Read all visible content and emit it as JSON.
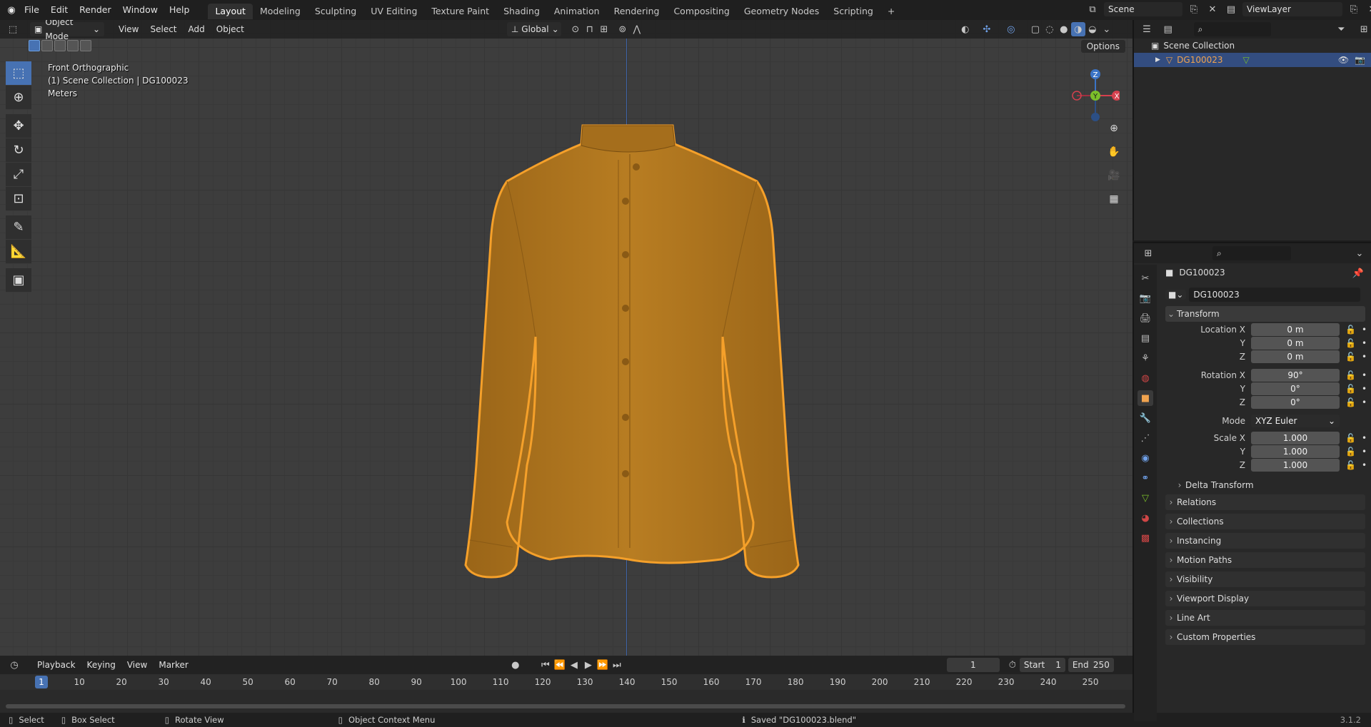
{
  "topbar": {
    "menus": [
      "File",
      "Edit",
      "Render",
      "Window",
      "Help"
    ],
    "workspaces": [
      "Layout",
      "Modeling",
      "Sculpting",
      "UV Editing",
      "Texture Paint",
      "Shading",
      "Animation",
      "Rendering",
      "Compositing",
      "Geometry Nodes",
      "Scripting"
    ],
    "active_workspace": "Layout",
    "add_tab": "+",
    "scene_name": "Scene",
    "view_layer": "ViewLayer"
  },
  "viewport": {
    "mode": "Object Mode",
    "menus": [
      "View",
      "Select",
      "Add",
      "Object"
    ],
    "transform_orientation": "Global",
    "options_label": "Options",
    "info": {
      "view": "Front Orthographic",
      "collection": "(1) Scene Collection | DG100023",
      "units": "Meters"
    },
    "gizmo": {
      "z": "Z",
      "y": "Y",
      "x": "X"
    },
    "shirt_color": "#b4781f",
    "outline_color": "#f5a02a"
  },
  "timeline": {
    "menus": [
      "Playback",
      "Keying",
      "View",
      "Marker"
    ],
    "current_frame": "1",
    "start_label": "Start",
    "start": "1",
    "end_label": "End",
    "end": "250",
    "ticks": [
      "1",
      "10",
      "20",
      "30",
      "40",
      "50",
      "60",
      "70",
      "80",
      "90",
      "100",
      "110",
      "120",
      "130",
      "140",
      "150",
      "160",
      "170",
      "180",
      "190",
      "200",
      "210",
      "220",
      "230",
      "240",
      "250"
    ]
  },
  "statusbar": {
    "select": "Select",
    "box_select": "Box Select",
    "rotate": "Rotate View",
    "context": "Object Context Menu",
    "message": "Saved \"DG100023.blend\"",
    "version": "3.1.2"
  },
  "outliner": {
    "root": "Scene Collection",
    "object": "DG100023"
  },
  "properties": {
    "object_name": "DG100023",
    "datablock": "DG100023",
    "transform_title": "Transform",
    "location": {
      "label_x": "Location X",
      "label_y": "Y",
      "label_z": "Z",
      "x": "0 m",
      "y": "0 m",
      "z": "0 m"
    },
    "rotation": {
      "label_x": "Rotation X",
      "label_y": "Y",
      "label_z": "Z",
      "x": "90°",
      "y": "0°",
      "z": "0°"
    },
    "mode_label": "Mode",
    "mode": "XYZ Euler",
    "scale": {
      "label_x": "Scale X",
      "label_y": "Y",
      "label_z": "Z",
      "x": "1.000",
      "y": "1.000",
      "z": "1.000"
    },
    "delta": "Delta Transform",
    "panels": [
      "Relations",
      "Collections",
      "Instancing",
      "Motion Paths",
      "Visibility",
      "Viewport Display",
      "Line Art",
      "Custom Properties"
    ]
  }
}
